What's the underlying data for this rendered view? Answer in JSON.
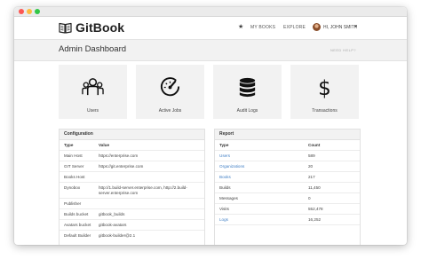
{
  "brand": {
    "name": "GitBook"
  },
  "nav": {
    "star": "★",
    "my_books": "MY BOOKS",
    "explore": "EXPLORE",
    "user": "HI, JOHN SMITH",
    "caret": "▾"
  },
  "header": {
    "title": "Admin Dashboard",
    "help": "NEED HELP?"
  },
  "cards": [
    {
      "label": "Users",
      "icon": "users-icon"
    },
    {
      "label": "Active Jobs",
      "icon": "speedometer-icon"
    },
    {
      "label": "Audit Logs",
      "icon": "database-icon"
    },
    {
      "label": "Transactions",
      "icon": "dollar-icon"
    }
  ],
  "config": {
    "title": "Configuration",
    "headers": [
      "Type",
      "Value"
    ],
    "rows": [
      {
        "type": "Main Host",
        "value": "https://enterprise.com",
        "value2": ""
      },
      {
        "type": "GIT Server",
        "value": "https://git.enterprise.com",
        "value2": ""
      },
      {
        "type": "Books Host",
        "value": "",
        "value2": ""
      },
      {
        "type": "Dynobox",
        "value": "http://1.build-server.enterprise.com, http://2.build-",
        "value2": "server.enterprise.com"
      },
      {
        "type": "Publisher",
        "value": "",
        "value2": ""
      },
      {
        "type": "Builds bucket",
        "value": "gitbook_builds",
        "value2": ""
      },
      {
        "type": "Avatars bucket",
        "value": "gitbook-avatars",
        "value2": ""
      },
      {
        "type": "Default Builder",
        "value": "gitbook-builder@2.1",
        "value2": ""
      }
    ]
  },
  "report": {
    "title": "Report",
    "headers": [
      "Type",
      "Count"
    ],
    "rows": [
      {
        "type": "Users",
        "count": "589"
      },
      {
        "type": "Organizations",
        "count": "20"
      },
      {
        "type": "Books",
        "count": "217"
      },
      {
        "type": "Builds",
        "count": "11,450"
      },
      {
        "type": "Messages",
        "count": "0"
      },
      {
        "type": "Visits",
        "count": "552,478"
      },
      {
        "type": "Logs",
        "count": "16,252"
      }
    ]
  },
  "colors": {
    "link": "#3f7ec4",
    "card_bg": "#f2f2f2",
    "header_bg": "#f2f2f2"
  }
}
